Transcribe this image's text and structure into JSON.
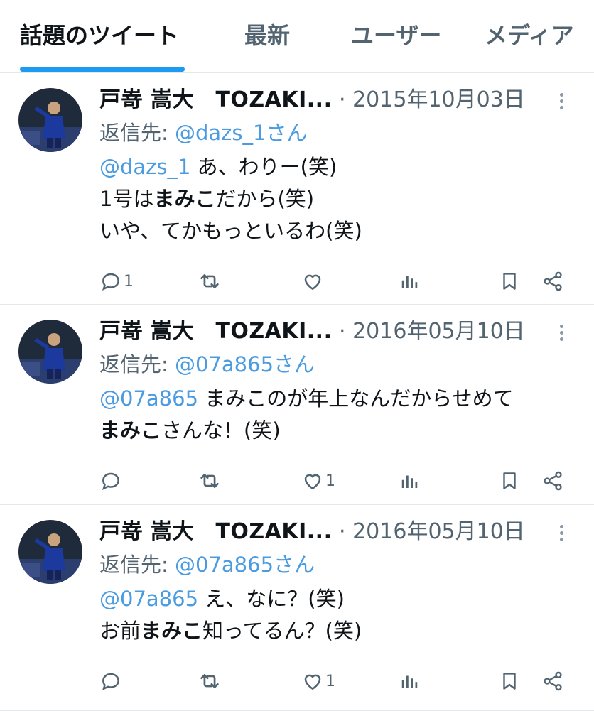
{
  "tabs": [
    {
      "label": "話題のツイート",
      "active": true
    },
    {
      "label": "最新",
      "active": false
    },
    {
      "label": "ユーザー",
      "active": false
    },
    {
      "label": "メディア",
      "active": false
    }
  ],
  "tweets": [
    {
      "author": "戸嵜 嵩大　TOZAKI...",
      "sep": " · ",
      "date": "2015年10月03日",
      "reply_prefix": "返信先: ",
      "reply_to": "@dazs_1さん",
      "lines": [
        [
          {
            "t": "@dazs_1",
            "k": "mention"
          },
          {
            "t": " あ、わりー(笑)",
            "k": "text"
          }
        ],
        [
          {
            "t": "1号は",
            "k": "text"
          },
          {
            "t": "まみこ",
            "k": "bold"
          },
          {
            "t": "だから(笑)",
            "k": "text"
          }
        ],
        [
          {
            "t": "いや、てかもっといるわ(笑)",
            "k": "text"
          }
        ]
      ],
      "counts": {
        "reply": "1",
        "like": ""
      }
    },
    {
      "author": "戸嵜 嵩大　TOZAKI...",
      "sep": " · ",
      "date": "2016年05月10日",
      "reply_prefix": "返信先: ",
      "reply_to": "@07a865さん",
      "lines": [
        [
          {
            "t": "@07a865",
            "k": "mention"
          },
          {
            "t": " まみこのが年上なんだからせめて",
            "k": "text"
          }
        ],
        [
          {
            "t": "まみこ",
            "k": "bold"
          },
          {
            "t": "さんな！(笑)",
            "k": "text"
          }
        ]
      ],
      "counts": {
        "reply": "",
        "like": "1"
      }
    },
    {
      "author": "戸嵜 嵩大　TOZAKI...",
      "sep": " · ",
      "date": "2016年05月10日",
      "reply_prefix": "返信先: ",
      "reply_to": "@07a865さん",
      "lines": [
        [
          {
            "t": "@07a865",
            "k": "mention"
          },
          {
            "t": " え、なに？(笑)",
            "k": "text"
          }
        ],
        [
          {
            "t": "お前",
            "k": "text"
          },
          {
            "t": "まみこ",
            "k": "bold"
          },
          {
            "t": "知ってるん？(笑)",
            "k": "text"
          }
        ]
      ],
      "counts": {
        "reply": "",
        "like": "1"
      }
    }
  ],
  "colors": {
    "accent": "#1d9bf0",
    "mention": "#4a9be0",
    "muted": "#536471"
  },
  "icons": [
    "reply-icon",
    "retweet-icon",
    "like-icon",
    "views-icon",
    "bookmark-icon",
    "share-icon",
    "more-icon"
  ]
}
